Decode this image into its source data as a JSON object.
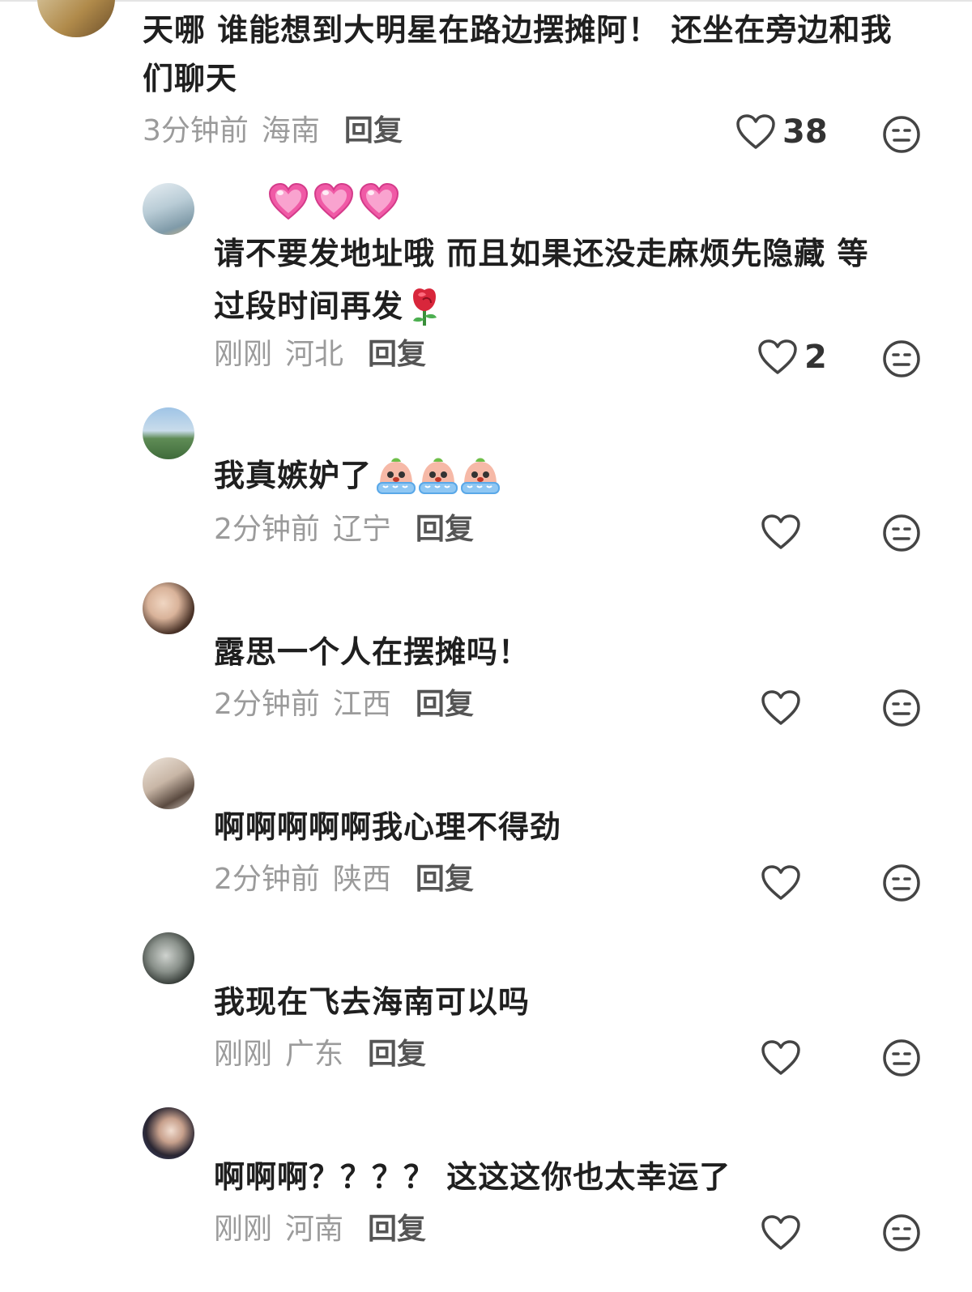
{
  "comments": [
    {
      "text1": "天哪 谁能想到大明星在路边摆摊阿！ 还坐在旁边和我",
      "text2": "们聊天",
      "time": "3分钟前",
      "location": "海南",
      "reply": "回复",
      "likes": "38"
    },
    {
      "emoji_line": "heart-emoji x3",
      "text1": "请不要发地址哦 而且如果还没走麻烦先隐藏 等",
      "text2": "过段时间再发",
      "time": "刚刚",
      "location": "河北",
      "reply": "回复",
      "likes": "2"
    },
    {
      "text1": "我真嫉妒了",
      "time": "2分钟前",
      "location": "辽宁",
      "reply": "回复"
    },
    {
      "text1": "露思一个人在摆摊吗！",
      "time": "2分钟前",
      "location": "江西",
      "reply": "回复"
    },
    {
      "text1": "啊啊啊啊啊我心理不得劲",
      "time": "2分钟前",
      "location": "陕西",
      "reply": "回复"
    },
    {
      "text1": "我现在飞去海南可以吗",
      "time": "刚刚",
      "location": "广东",
      "reply": "回复"
    },
    {
      "text1": "啊啊啊？？？？ 这这这你也太幸运了",
      "time": "刚刚",
      "location": "河南",
      "reply": "回复"
    }
  ],
  "colors": {
    "text": "#1f1f1f",
    "meta": "#9b9b9b",
    "heart_emoji": "#f05aa6",
    "icon": "#444444"
  }
}
